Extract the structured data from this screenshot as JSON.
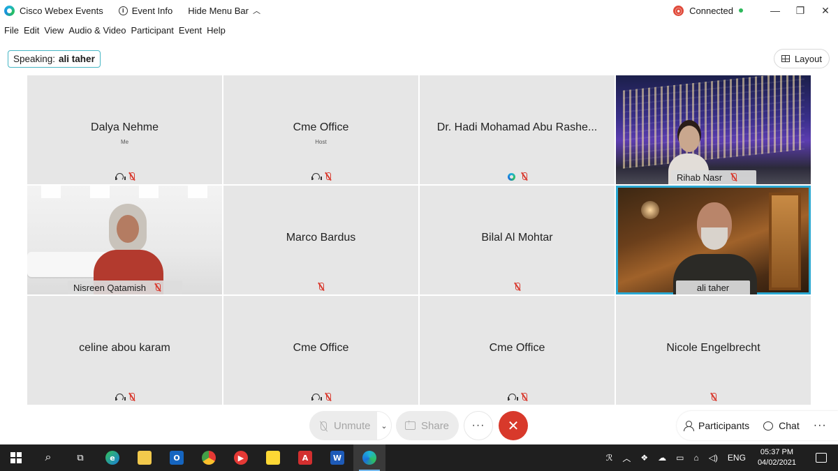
{
  "titlebar": {
    "app_name": "Cisco Webex Events",
    "event_info": "Event Info",
    "hide_menu_bar": "Hide Menu Bar",
    "connection_status": "Connected",
    "connection_color": "#2eb85c",
    "window_buttons": [
      "—",
      "❐",
      "✕"
    ]
  },
  "menu": {
    "items": [
      "File",
      "Edit",
      "View",
      "Audio & Video",
      "Participant",
      "Event",
      "Help"
    ]
  },
  "speaking": {
    "label": "Speaking:",
    "name": "ali taher"
  },
  "layout_button": "Layout",
  "participants_grid": [
    {
      "name": "Dalya Nehme",
      "role": "Me",
      "icons": [
        "headset-icon",
        "mute-icon"
      ]
    },
    {
      "name": "Cme Office",
      "role": "Host",
      "icons": [
        "headset-icon",
        "mute-icon"
      ]
    },
    {
      "name": "Dr. Hadi Mohamad Abu Rashe...",
      "role": "",
      "icons": [
        "webex-icon",
        "mute-icon"
      ]
    },
    {
      "name": "Rihab Nasr",
      "video": true
    },
    {
      "name": "Nisreen Qatamish",
      "video": true
    },
    {
      "name": "Marco Bardus",
      "role": "",
      "icons": [
        "mute-icon"
      ]
    },
    {
      "name": "Bilal Al Mohtar",
      "role": "",
      "icons": [
        "mute-icon"
      ]
    },
    {
      "name": "ali taher",
      "video": true,
      "active_speaker": true
    },
    {
      "name": "celine abou karam",
      "role": "",
      "icons": [
        "headset-icon",
        "mute-icon"
      ]
    },
    {
      "name": "Cme Office",
      "role": "",
      "icons": [
        "headset-icon",
        "mute-icon"
      ]
    },
    {
      "name": "Cme Office",
      "role": "",
      "icons": [
        "headset-icon",
        "mute-icon"
      ]
    },
    {
      "name": "Nicole Engelbrecht",
      "role": "",
      "icons": [
        "mute-icon"
      ]
    }
  ],
  "controls": {
    "unmute": "Unmute",
    "share": "Share",
    "more": "···",
    "leave_color": "#d8392b",
    "participants": "Participants",
    "chat": "Chat"
  },
  "taskbar": {
    "apps": [
      "windows-start-icon",
      "search-icon",
      "task-view-icon",
      "edge-icon",
      "file-explorer-icon",
      "outlook-icon",
      "chrome-icon",
      "media-player-icon",
      "sticky-notes-icon",
      "acrobat-icon",
      "word-icon",
      "webex-icon"
    ],
    "language": "ENG",
    "time": "05:37 PM",
    "date": "04/02/2021"
  },
  "colors": {
    "active_speaker_border": "#2aa8d2",
    "speaking_border": "#46b6c4",
    "mute_red": "#d93a2f"
  }
}
